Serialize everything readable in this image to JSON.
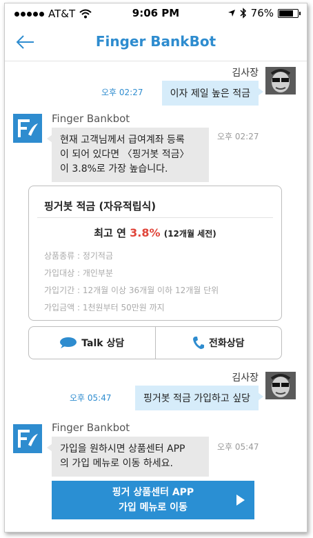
{
  "status_bar": {
    "carrier": "AT&T",
    "time": "9:06 PM",
    "battery": "76%",
    "battery_level": 0.76
  },
  "header": {
    "title": "Finger BankBot"
  },
  "messages": {
    "user1": {
      "name": "김사장",
      "text": "이자 제일 높은 적금",
      "time": "오후 02:27"
    },
    "bot1": {
      "name": "Finger Bankbot",
      "lines": [
        "현재 고객님께서 급여계좌 등록",
        "이 되어 있다면 〈핑거봇 적금〉",
        "이 3.8%로 가장 높습니다."
      ],
      "time": "오후 02:27"
    },
    "user2": {
      "name": "김사장",
      "text": "핑거봇 적금 가입하고 싶당",
      "time": "오후 05:47"
    },
    "bot2": {
      "name": "Finger Bankbot",
      "lines": [
        "가입을 원하시면 상품센터 APP",
        "의 가입 메뉴로 이동 하세요."
      ],
      "time": "오후 05:47"
    }
  },
  "card": {
    "title": "핑거봇 적금 (자유적립식)",
    "rate_prefix": "최고 연",
    "rate": "3.8%",
    "rate_period": "(12개월 세전)",
    "details": [
      "상품종류 : 정기적금",
      "가입대상 : 개인부분",
      "가입기간 : 12개월 이상 36개월 이하 12개월 단위",
      "가입금액 : 1천원부터 50만원 까지"
    ]
  },
  "actions": {
    "talk": "Talk 상담",
    "phone": "전화상담"
  },
  "cta": {
    "line1": "핑거 상품센터 APP",
    "line2": "가입 메뉴로 이동"
  }
}
